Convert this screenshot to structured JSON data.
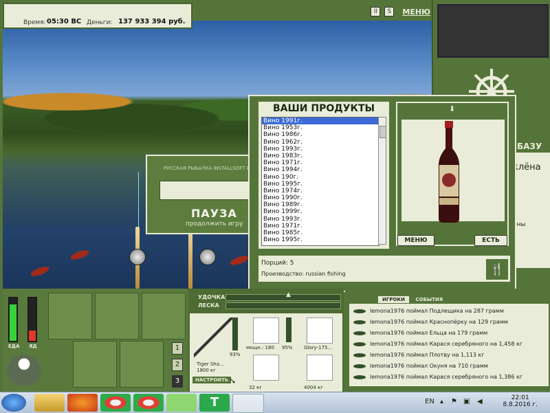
{
  "status": {
    "time_label": "Время:",
    "time_value": "05:30 ВС",
    "money_label": "Деньги:",
    "money_value": "137 933 394 руб."
  },
  "top": {
    "pause_icon": "pause-icon",
    "s_icon": "S",
    "menu_label": "МЕНЮ"
  },
  "right_panel": {
    "text1": "БАЗУ",
    "text2": "клёна",
    "text3": "ены"
  },
  "pause_dialog": {
    "header": "РУССКАЯ РЫБАЛКА INSTALLSOFT ED",
    "title": "ПАУЗА",
    "subtitle": "продолжить игру"
  },
  "products": {
    "title": "ВАШИ ПРОДУКТЫ",
    "items": [
      "Вино 1991г.",
      "Вино 1953г.",
      "Вино 1986г.",
      "Вино 1962г.",
      "Вино 1993г.",
      "Вино 1983г.",
      "Вино 1971г.",
      "Вино 1994г.",
      "Вино 190г.",
      "Вино 1995г.",
      "Вино 1974г.",
      "Вино 1990г.",
      "Вино 1989г.",
      "Вино 1999г.",
      "Вино 1993г.",
      "Вино 1971г.",
      "Вино 1985г.",
      "Вино 1995г."
    ],
    "selected_index": 0,
    "menu_button": "МЕНЮ",
    "eat_button": "ЕСТЬ",
    "portions_text": "Порций: 5",
    "producer_text": "Производство: russian fishing"
  },
  "left_panel": {
    "food_label": "ЕДА",
    "poison_label": "ЯД",
    "food_level": 0.85,
    "poison_level": 0.25,
    "slot_buttons": [
      "1",
      "2",
      "3"
    ]
  },
  "rod_panel": {
    "rod_label": "УДОЧКА",
    "line_label": "ЛЕСКА",
    "rod_name": "Tiger Sha...",
    "rod_weight": "1800 кг",
    "setup_button": "НАСТРОИТЬ",
    "rod_percent": "93%",
    "reel_label": "мощн.: 180",
    "reel_percent": "95%",
    "line_name": "Glory-175...",
    "hook_weight": "32 кг",
    "bait_weight": "4004 кг"
  },
  "log": {
    "tabs": [
      "ИГРОКИ",
      "СОБЫТИЯ"
    ],
    "lines": [
      "lemona1976 поймал Подлещика на 287 грамм",
      "lemona1976 поймал Краснопёрку на 129 грамм",
      "lemona1976 поймал Ельца на 179 грамм",
      "lemona1976 поймал Карася серебряного на 1,458 кг",
      "lemona1976 поймал Плотву на 1,113 кг",
      "lemona1976 поймал Окуня на 710 грамм",
      "lemona1976 поймал Карася серебряного на 1,386 кг"
    ]
  },
  "taskbar": {
    "lang": "EN",
    "time": "22:01",
    "date": "8.8.2016 г."
  }
}
